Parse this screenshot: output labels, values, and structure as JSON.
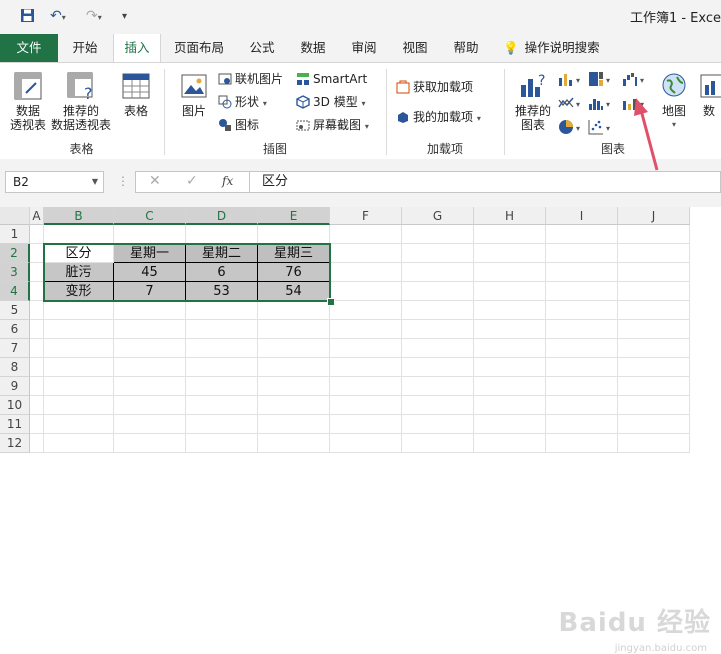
{
  "window": {
    "title": "工作簿1 - Exce"
  },
  "tabs": [
    {
      "id": "file",
      "label": "文件"
    },
    {
      "id": "home",
      "label": "开始"
    },
    {
      "id": "insert",
      "label": "插入"
    },
    {
      "id": "layout",
      "label": "页面布局"
    },
    {
      "id": "formulas",
      "label": "公式"
    },
    {
      "id": "data",
      "label": "数据"
    },
    {
      "id": "review",
      "label": "审阅"
    },
    {
      "id": "view",
      "label": "视图"
    },
    {
      "id": "help",
      "label": "帮助"
    }
  ],
  "tell_me": {
    "label": "操作说明搜索"
  },
  "ribbon": {
    "tables": {
      "group": "表格",
      "pivot": "数据\n透视表",
      "pivot_line1": "数据",
      "pivot_line2": "透视表",
      "rec_pivot_line1": "推荐的",
      "rec_pivot_line2": "数据透视表",
      "table": "表格"
    },
    "illustrations": {
      "group": "插图",
      "picture": "图片",
      "online_picture": "联机图片",
      "shapes": "形状",
      "icons": "图标",
      "smartart": "SmartArt",
      "model3d": "3D 模型",
      "screenshot": "屏幕截图"
    },
    "addins": {
      "group": "加载项",
      "get": "获取加载项",
      "my": "我的加载项"
    },
    "charts": {
      "group": "图表",
      "rec_line1": "推荐的",
      "rec_line2": "图表",
      "map": "地图",
      "more": "数"
    }
  },
  "formula_bar": {
    "name_box": "B2",
    "fx": "fx",
    "content": "区分"
  },
  "grid": {
    "columns": [
      "A",
      "B",
      "C",
      "D",
      "E",
      "F",
      "G",
      "H",
      "I",
      "J"
    ],
    "rows": [
      "1",
      "2",
      "3",
      "4",
      "5",
      "6",
      "7",
      "8",
      "9",
      "10",
      "11",
      "12"
    ],
    "table": [
      [
        "区分",
        "星期一",
        "星期二",
        "星期三"
      ],
      [
        "脏污",
        "45",
        "6",
        "76"
      ],
      [
        "变形",
        "7",
        "53",
        "54"
      ]
    ]
  },
  "watermark": {
    "main": "Baidu 经验",
    "sub": "jingyan.baidu.com"
  },
  "colors": {
    "accent": "#217346",
    "arrow": "#e0506a"
  }
}
